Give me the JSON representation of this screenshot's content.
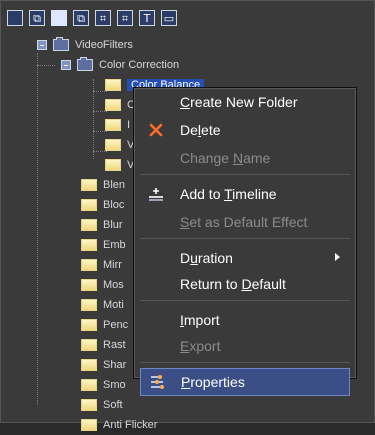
{
  "toolbar": {
    "buttons": [
      {
        "name": "view-list-icon",
        "glyph": ""
      },
      {
        "name": "view-details-icon",
        "glyph": "⧉"
      },
      {
        "name": "view-solid-icon",
        "glyph": ""
      },
      {
        "name": "view-split-icon",
        "glyph": "⧉"
      },
      {
        "name": "grid-icon",
        "glyph": "⌗"
      },
      {
        "name": "layout-icon",
        "glyph": "⌗"
      },
      {
        "name": "text-icon",
        "glyph": "T"
      },
      {
        "name": "window-icon",
        "glyph": "▭"
      }
    ]
  },
  "tree": {
    "root": "VideoFilters",
    "category": "Color Correction",
    "selected_item": "Color Balance",
    "subitems_prefix": [
      "C",
      "I",
      "V",
      "V"
    ],
    "items": [
      "Blen",
      "Bloc",
      "Blur",
      "Emb",
      "Mirr",
      "Mos",
      "Moti",
      "Penc",
      "Rast",
      "Shar",
      "Smo",
      "Soft",
      "Anti Flicker"
    ]
  },
  "context_menu": {
    "items": [
      {
        "label": "Create New Folder",
        "underline": "C",
        "rest": "reate New Folder",
        "enabled": true,
        "icon": ""
      },
      {
        "label": "Delete",
        "underline": "l",
        "pre": "De",
        "rest": "ete",
        "enabled": true,
        "icon": "close-x-icon"
      },
      {
        "label": "Change Name",
        "pre": "Change ",
        "underline": "N",
        "rest": "ame",
        "enabled": false,
        "icon": ""
      },
      {
        "label": "Add to Timeline",
        "pre": "Add to ",
        "underline": "T",
        "rest": "imeline",
        "enabled": true,
        "icon": "add-to-timeline-icon"
      },
      {
        "label": "Set as Default Effect",
        "underline": "S",
        "rest": "et as Default Effect",
        "enabled": false,
        "icon": ""
      },
      {
        "label": "Duration",
        "pre": "D",
        "underline": "u",
        "rest": "ration",
        "enabled": true,
        "icon": "",
        "submenu": true
      },
      {
        "label": "Return to Default",
        "pre": "Return to ",
        "underline": "D",
        "rest": "efault",
        "enabled": true,
        "icon": ""
      },
      {
        "label": "Import",
        "underline": "I",
        "rest": "mport",
        "enabled": true,
        "icon": ""
      },
      {
        "label": "Export",
        "underline": "E",
        "rest": "xport",
        "enabled": false,
        "icon": ""
      },
      {
        "label": "Properties",
        "underline": "P",
        "rest": "roperties",
        "enabled": true,
        "icon": "properties-icon",
        "highlighted": true
      }
    ]
  },
  "colors": {
    "background": "#3a3a3a",
    "selection": "#264fb6",
    "menu_hover": "#3b4f86",
    "delete_icon": "#ff6a2b"
  }
}
